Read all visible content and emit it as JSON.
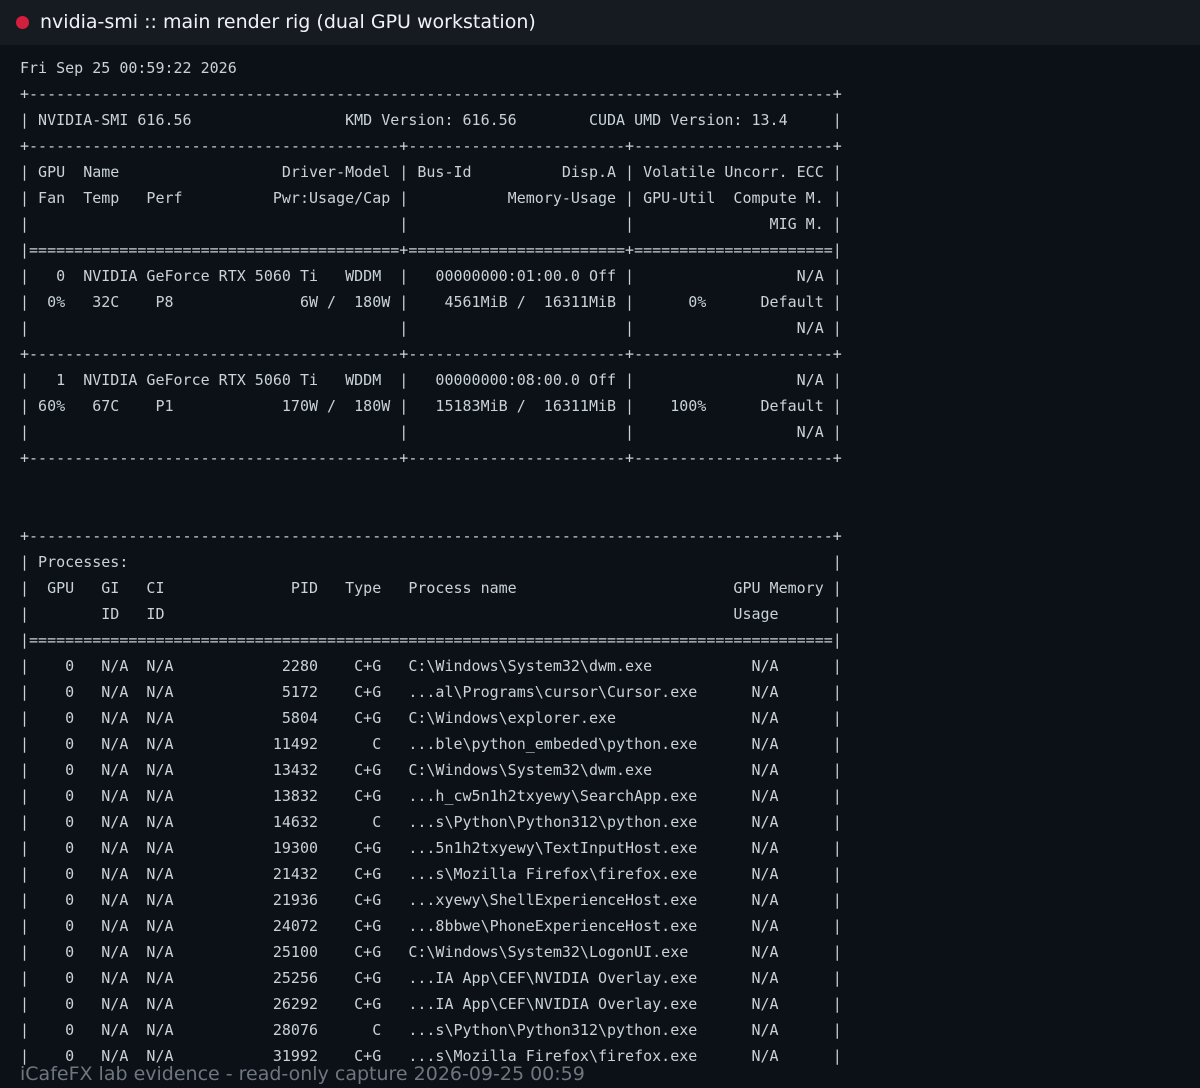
{
  "window": {
    "title": "nvidia-smi :: main render rig (dual GPU workstation)"
  },
  "terminal": {
    "lines": [
      "Fri Sep 25 00:59:22 2026",
      "+-----------------------------------------------------------------------------------------+",
      "| NVIDIA-SMI 616.56                 KMD Version: 616.56        CUDA UMD Version: 13.4     |",
      "+-----------------------------------------+------------------------+----------------------+",
      "| GPU  Name                  Driver-Model | Bus-Id          Disp.A | Volatile Uncorr. ECC |",
      "| Fan  Temp   Perf          Pwr:Usage/Cap |           Memory-Usage | GPU-Util  Compute M. |",
      "|                                         |                        |               MIG M. |",
      "|=========================================+========================+======================|",
      "|   0  NVIDIA GeForce RTX 5060 Ti   WDDM  |   00000000:01:00.0 Off |                  N/A |",
      "|  0%   32C    P8              6W /  180W |    4561MiB /  16311MiB |      0%      Default |",
      "|                                         |                        |                  N/A |",
      "+-----------------------------------------+------------------------+----------------------+",
      "|   1  NVIDIA GeForce RTX 5060 Ti   WDDM  |   00000000:08:00.0 Off |                  N/A |",
      "| 60%   67C    P1            170W /  180W |   15183MiB /  16311MiB |    100%      Default |",
      "|                                         |                        |                  N/A |",
      "+-----------------------------------------+------------------------+----------------------+",
      "",
      "",
      "+-----------------------------------------------------------------------------------------+",
      "| Processes:                                                                              |",
      "|  GPU   GI   CI              PID   Type   Process name                        GPU Memory |",
      "|        ID   ID                                                               Usage      |",
      "|=========================================================================================|",
      "|    0   N/A  N/A            2280    C+G   C:\\Windows\\System32\\dwm.exe           N/A      |",
      "|    0   N/A  N/A            5172    C+G   ...al\\Programs\\cursor\\Cursor.exe      N/A      |",
      "|    0   N/A  N/A            5804    C+G   C:\\Windows\\explorer.exe               N/A      |",
      "|    0   N/A  N/A           11492      C   ...ble\\python_embeded\\python.exe      N/A      |",
      "|    0   N/A  N/A           13432    C+G   C:\\Windows\\System32\\dwm.exe           N/A      |",
      "|    0   N/A  N/A           13832    C+G   ...h_cw5n1h2txyewy\\SearchApp.exe      N/A      |",
      "|    0   N/A  N/A           14632      C   ...s\\Python\\Python312\\python.exe      N/A      |",
      "|    0   N/A  N/A           19300    C+G   ...5n1h2txyewy\\TextInputHost.exe      N/A      |",
      "|    0   N/A  N/A           21432    C+G   ...s\\Mozilla Firefox\\firefox.exe      N/A      |",
      "|    0   N/A  N/A           21936    C+G   ...xyewy\\ShellExperienceHost.exe      N/A      |",
      "|    0   N/A  N/A           24072    C+G   ...8bbwe\\PhoneExperienceHost.exe      N/A      |",
      "|    0   N/A  N/A           25100    C+G   C:\\Windows\\System32\\LogonUI.exe       N/A      |",
      "|    0   N/A  N/A           25256    C+G   ...IA App\\CEF\\NVIDIA Overlay.exe      N/A      |",
      "|    0   N/A  N/A           26292    C+G   ...IA App\\CEF\\NVIDIA Overlay.exe      N/A      |",
      "|    0   N/A  N/A           28076      C   ...s\\Python\\Python312\\python.exe      N/A      |",
      "|    0   N/A  N/A           31992    C+G   ...s\\Mozilla Firefox\\firefox.exe      N/A      |"
    ]
  },
  "footer": {
    "text": "iCafeFX lab evidence - read-only capture 2026-09-25 00:59"
  },
  "colors": {
    "background": "#0c1117",
    "titlebar": "#161b22",
    "record_dot": "#d21f3c",
    "text": "#c9d1d9",
    "footer_text": "#6e7681"
  }
}
